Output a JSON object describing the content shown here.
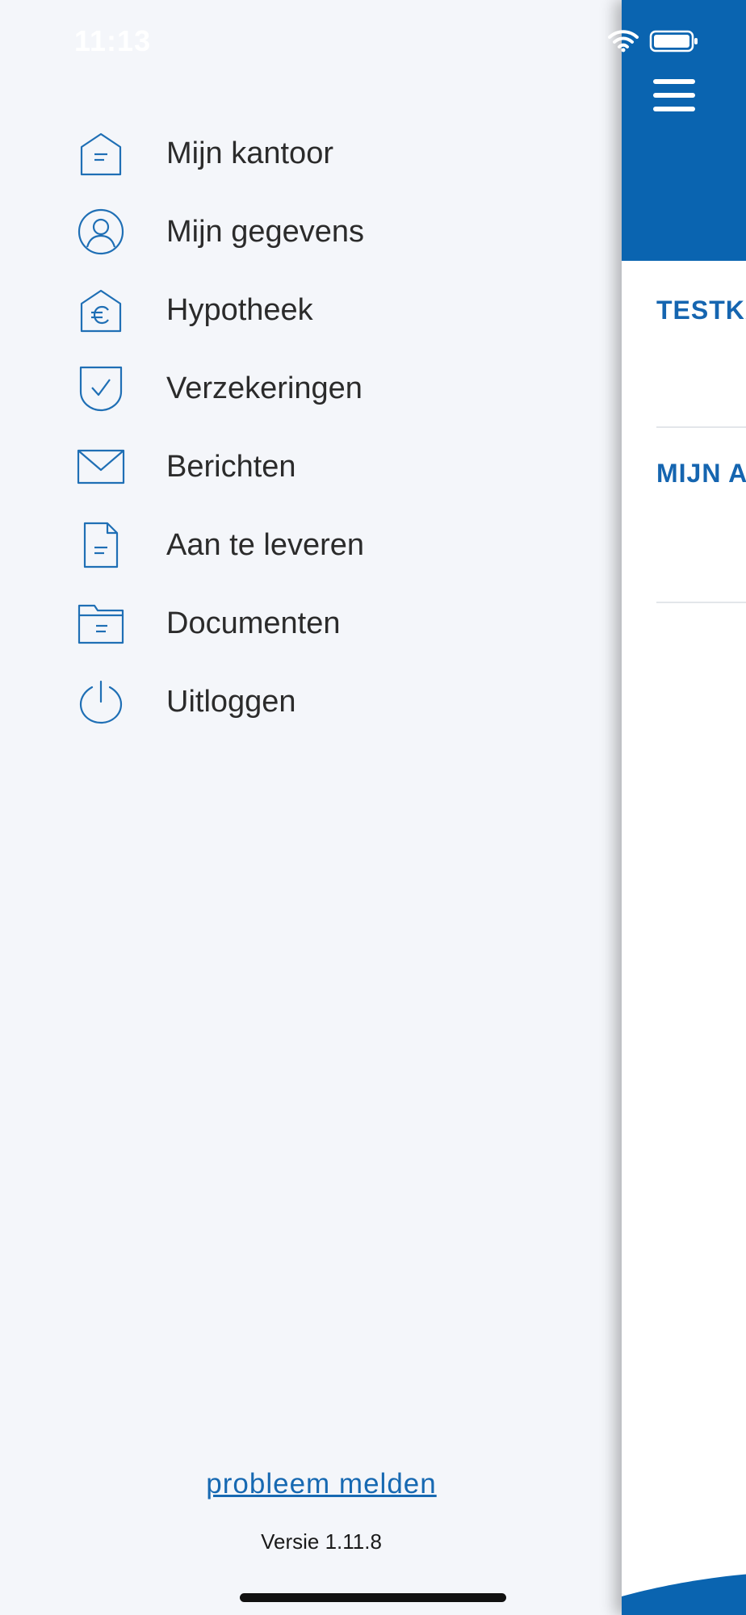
{
  "status_bar": {
    "time": "11:13",
    "wifi_icon": "wifi-icon",
    "battery_icon": "battery-icon"
  },
  "menu": {
    "items": [
      {
        "label": "Mijn kantoor",
        "icon": "office-house-icon"
      },
      {
        "label": "Mijn gegevens",
        "icon": "user-profile-icon"
      },
      {
        "label": "Hypotheek",
        "icon": "mortgage-euro-house-icon"
      },
      {
        "label": "Verzekeringen",
        "icon": "shield-check-icon"
      },
      {
        "label": "Berichten",
        "icon": "envelope-icon"
      },
      {
        "label": "Aan te leveren",
        "icon": "document-icon"
      },
      {
        "label": "Documenten",
        "icon": "folder-icon"
      },
      {
        "label": "Uitloggen",
        "icon": "power-icon"
      }
    ]
  },
  "footer": {
    "report_link": "probleem melden",
    "version": "Versie 1.11.8"
  },
  "main_panel": {
    "menu_icon": "hamburger-menu-icon",
    "sections": [
      {
        "title": "TESTKA"
      },
      {
        "title": "MIJN A"
      }
    ]
  },
  "colors": {
    "accent": "#0a64b0",
    "link": "#1769b2",
    "icon": "#1f6fb5",
    "drawer_background": "#f4f6fa"
  }
}
